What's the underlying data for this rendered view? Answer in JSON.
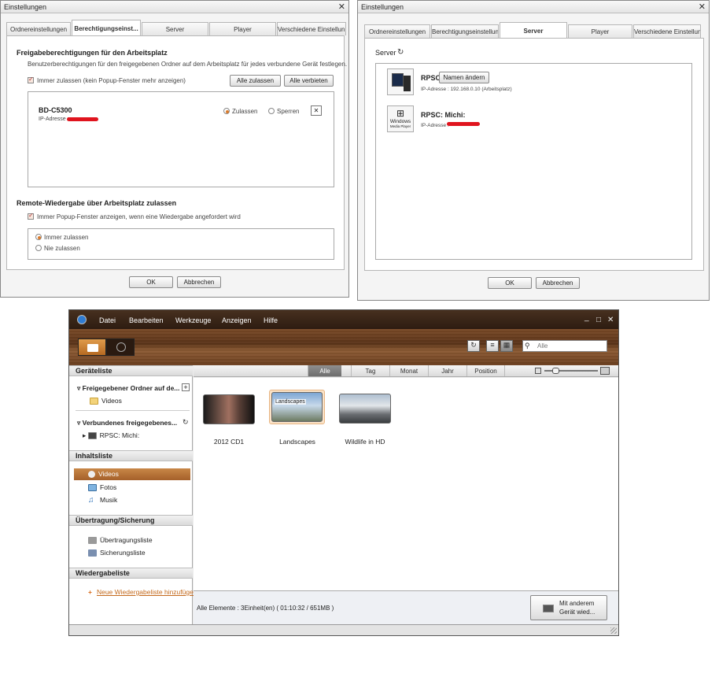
{
  "dialog_left": {
    "title": "Einstellungen",
    "tabs": [
      "Ordnereinstellungen",
      "Berechtigungseinst...",
      "Server",
      "Player",
      "Verschiedene Einstellun..."
    ],
    "section1_title": "Freigabeberechtigungen für den Arbeitsplatz",
    "section1_desc": "Benutzerberechtigungen für den freigegebenen Ordner auf dem Arbeitsplatz für jedes verbundene Gerät festlegen.",
    "always_allow_label": "Immer zulassen (kein Popup-Fenster mehr anzeigen)",
    "allow_all_button": "Alle zulassen",
    "deny_all_button": "Alle verbieten",
    "device_name": "BD-C5300",
    "device_ip_label": "IP-Adresse :",
    "allow_radio": "Zulassen",
    "block_radio": "Sperren",
    "remove_button": "✕",
    "section2_title": "Remote-Wiedergabe über Arbeitsplatz zulassen",
    "popup_label": "Immer Popup-Fenster anzeigen, wenn eine Wiedergabe angefordert wird",
    "radio_always": "Immer zulassen",
    "radio_never": "Nie zulassen",
    "ok_button": "OK",
    "cancel_button": "Abbrechen"
  },
  "dialog_right": {
    "title": "Einstellungen",
    "tabs": [
      "Ordnereinstellungen",
      "Berechtigungseinstellun...",
      "Server",
      "Player",
      "Verschiedene Einstellun..."
    ],
    "server_label": "Server",
    "refresh_icon": "↻",
    "server1_name": "RPSC",
    "rename_button": "Namen ändern",
    "server1_ip": "IP-Adresse : 192.168.0.10 (Arbeitsplatz)",
    "server2_name": "RPSC: Michi:",
    "server2_ip_label": "IP-Adresse :",
    "wmp_label_1": "Windows",
    "wmp_label_2": "Media Player",
    "ok_button": "OK",
    "cancel_button": "Abbrechen"
  },
  "app": {
    "menu": [
      "Datei",
      "Bearbeiten",
      "Werkzeuge",
      "Anzeigen",
      "Hilfe"
    ],
    "window_controls": [
      "_",
      "□",
      "✕"
    ],
    "search_placeholder": "Alle",
    "sidebar": {
      "devices_header": "Geräteliste",
      "shared_folder": "Freigegebener Ordner auf de...",
      "videos_folder": "Videos",
      "connected_shared": "Verbundenes freigegebenes...",
      "rpsc_item": "RPSC: Michi:",
      "content_header": "Inhaltsliste",
      "videos": "Videos",
      "photos": "Fotos",
      "music": "Musik",
      "transfer_header": "Übertragung/Sicherung",
      "transfer_list": "Übertragungsliste",
      "backup_list": "Sicherungsliste",
      "playlist_header": "Wiedergabeliste",
      "new_playlist": "Neue Wiedergabeliste hinzufügen"
    },
    "filter_tabs": [
      "Alle",
      "Tag",
      "Monat",
      "Jahr",
      "Position"
    ],
    "items": [
      {
        "label": "2012 CD1"
      },
      {
        "label": "Landscapes",
        "overlay": "Landscapes"
      },
      {
        "label": "Wildlife in HD"
      }
    ],
    "status_text": "Alle Elemente : 3Einheit(en) ( 01:10:32 / 651MB )",
    "other_device_button_line1": "Mit anderem",
    "other_device_button_line2": "Gerät wied..."
  }
}
